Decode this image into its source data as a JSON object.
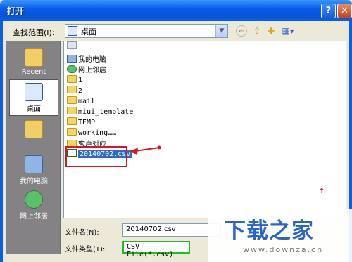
{
  "window": {
    "title": "打开",
    "help_glyph": "?",
    "close_glyph": "✕"
  },
  "look_in": {
    "label": "查找范围(I):",
    "value": "桌面",
    "dropdown_glyph": "▼"
  },
  "toolbar": {
    "back_glyph": "←",
    "up_glyph": "⇧",
    "new_folder_glyph": "✚",
    "views_glyph": "▦▾"
  },
  "places": [
    {
      "label": "Recent",
      "icon": "recent-folder-icon"
    },
    {
      "label": "桌面",
      "icon": "desktop-icon"
    },
    {
      "label": "",
      "icon": "my-documents-icon"
    },
    {
      "label": "我的电脑",
      "icon": "my-computer-icon"
    },
    {
      "label": "网上邻居",
      "icon": "network-icon"
    }
  ],
  "files": [
    {
      "name": "",
      "icon": "documents-icon"
    },
    {
      "name": "我的电脑",
      "icon": "computer-icon"
    },
    {
      "name": "网上邻居",
      "icon": "network-icon"
    },
    {
      "name": "1",
      "icon": "folder-icon"
    },
    {
      "name": "2",
      "icon": "folder-icon"
    },
    {
      "name": "mail",
      "icon": "folder-icon"
    },
    {
      "name": "miui_template",
      "icon": "folder-icon"
    },
    {
      "name": "TEMP",
      "icon": "folder-icon"
    },
    {
      "name": "working……",
      "icon": "folder-icon"
    },
    {
      "name": "客户对应",
      "icon": "folder-icon"
    },
    {
      "name": "20140702.csv",
      "icon": "csv-file-icon"
    }
  ],
  "annotation": {
    "marker": "↑"
  },
  "file_name": {
    "label": "文件名(N):",
    "value": "20140702.csv"
  },
  "file_type": {
    "label": "文件类型(T):",
    "value": "CSV File(*.csv)"
  },
  "watermark": {
    "title": "下载之家",
    "url": "www.downza.cn"
  },
  "colors": {
    "selection": "#316ac5",
    "highlight_red": "#d8161c",
    "highlight_green": "#19c419",
    "titlebar": "#0a5ee8"
  }
}
